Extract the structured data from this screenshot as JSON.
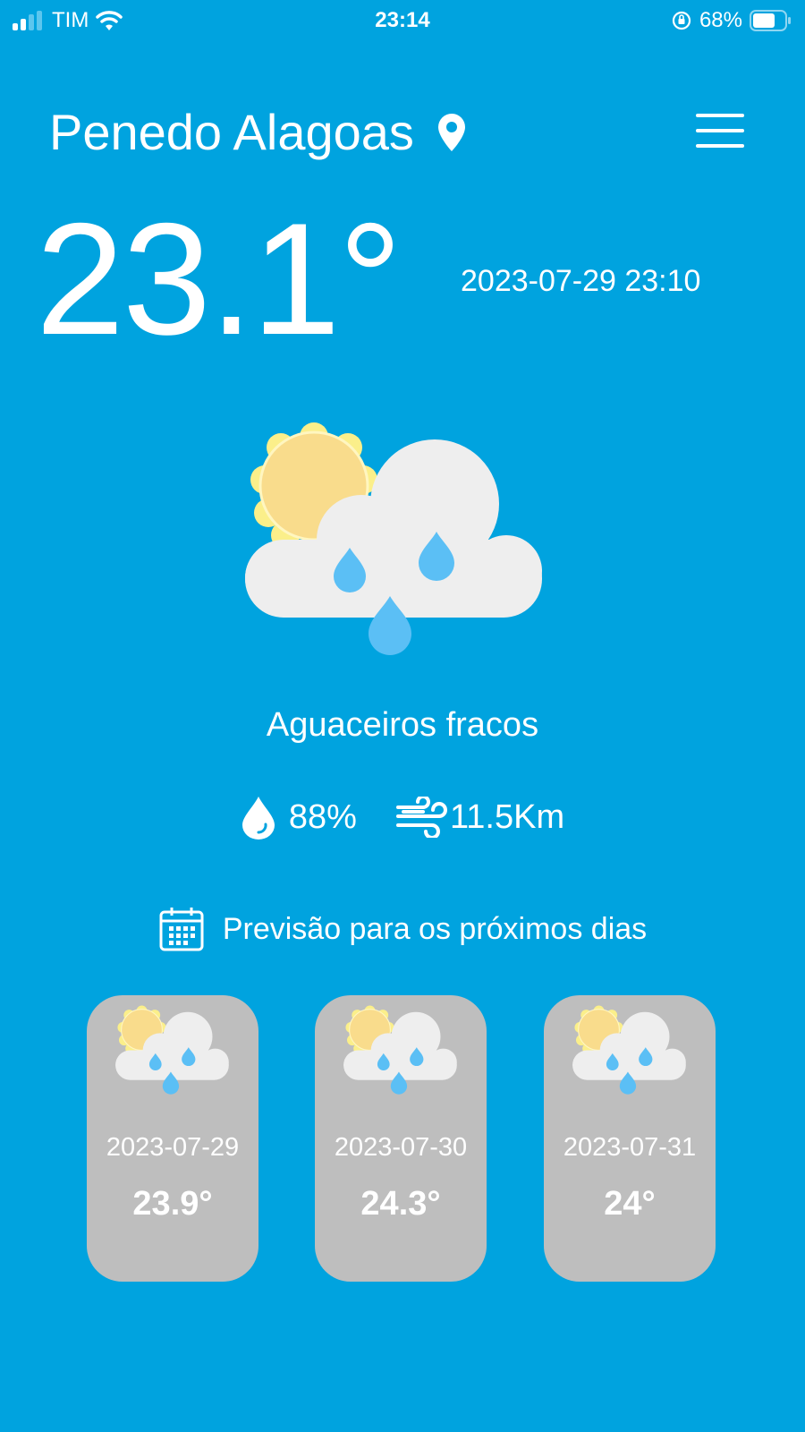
{
  "status_bar": {
    "carrier": "TIM",
    "time": "23:14",
    "battery": "68%"
  },
  "header": {
    "location": "Penedo Alagoas",
    "location_icon": "map-pin-icon",
    "menu_icon": "hamburger-menu-icon"
  },
  "current": {
    "temperature": "23.1°",
    "datetime": "2023-07-29 23:10",
    "condition": "Aguaceiros fracos",
    "condition_icon": "sun-cloud-rain-icon",
    "humidity": "88%",
    "wind": "11.5Km"
  },
  "forecast": {
    "heading": "Previsão para os próximos dias",
    "days": [
      {
        "date": "2023-07-29",
        "temp": "23.9°"
      },
      {
        "date": "2023-07-30",
        "temp": "24.3°"
      },
      {
        "date": "2023-07-31",
        "temp": "24°"
      }
    ]
  },
  "colors": {
    "background": "#00A3DF",
    "card": "#BEBEBE",
    "cloud": "#EEEEEE",
    "sun": "#F9DC8C",
    "sun_ring": "#FBEF8A",
    "drop": "#5BBFF5"
  }
}
